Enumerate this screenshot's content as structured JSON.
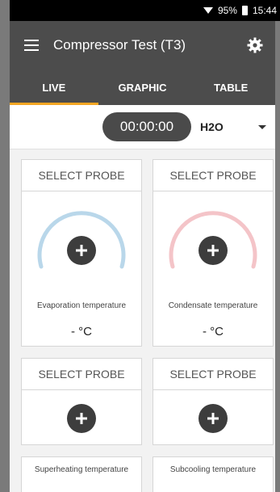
{
  "status": {
    "battery_percent": "95%",
    "time": "15:44"
  },
  "appbar": {
    "title": "Compressor Test (T3)",
    "menu_icon": "hamburger-menu-icon",
    "settings_icon": "gear-icon"
  },
  "tabs": [
    {
      "label": "LIVE",
      "active": true
    },
    {
      "label": "GRAPHIC",
      "active": false
    },
    {
      "label": "TABLE",
      "active": false
    }
  ],
  "timer": {
    "value": "00:00:00"
  },
  "medium": {
    "selected": "H2O"
  },
  "colors": {
    "evaporation_arc": "#b9d7ea",
    "condensate_arc": "#f4c4c8",
    "tab_indicator": "#f5a623",
    "appbar": "#4c4c4c"
  },
  "cards": [
    {
      "header": "SELECT PROBE",
      "label": "Evaporation temperature",
      "value": "- °C"
    },
    {
      "header": "SELECT PROBE",
      "label": "Condensate temperature",
      "value": "- °C"
    },
    {
      "header": "SELECT PROBE",
      "label": "Superheating temperature"
    },
    {
      "header": "SELECT PROBE",
      "label": "Subcooling temperature"
    }
  ]
}
